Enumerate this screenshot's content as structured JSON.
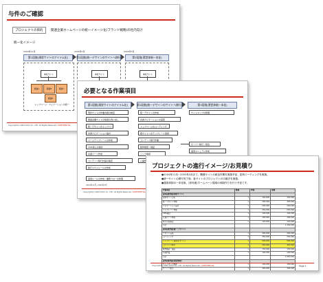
{
  "slide1": {
    "title": "与件のご確認",
    "purpose_label": "プロジェクトの目的",
    "purpose_text": "関連企業ホームページの統一イメージ化(ブランド戦略)の社内向け",
    "section_label": "統一化イメージ",
    "phases": [
      "第1段階(現状サイトのアイテム化)",
      "第2段階(統一デザインのサイトへ移行)",
      "第3段階(運営体制一本化)"
    ],
    "phase_side_labels": [
      "2004年11月",
      "2005年1月",
      "2005年3月"
    ],
    "box_labels": [
      "本社サイト",
      "関連A",
      "関連B",
      "関連C"
    ],
    "note": "トップページ・ナビゲーションの統一",
    "footer_copy": "Copyright(C) 2004 XXXX Co., LTD. All Rights Reserved.",
    "footer_mark": "CONFIDENTIAL"
  },
  "slide2": {
    "title": "必要となる作業項目",
    "phases": [
      "第1段階(現状サイトのアイテム化)",
      "第2段階(統一デザインのサイトへ移行)",
      "第3段階(運営体制一本化)"
    ],
    "col1": [
      "現状サイトの作業内容の精査",
      "関連企業サイトの情報の洗い出し",
      "統一デザインのトップページ作成",
      "共通ナビゲーション設計",
      "ページテンプレートの作成",
      "CMS導入の検討",
      "共通パーツ作成",
      "コンテンツ移行計画の策定",
      "移行スケジュールの作成",
      "運用ルールの作成・業務フローの整理"
    ],
    "col2": [
      "統一デザインの作成",
      "共通ナビゲーションの実装",
      "トップページのコーディング",
      "各サイトへのテンプレート適用",
      "コンテンツ移行作業",
      "動作確認・検証",
      "リンク確認",
      "公開作業"
    ],
    "col3": [
      "サイトマップの整理",
      "サーバー移行・統合",
      "運用マニュアル作成",
      "CMS運用トレーニング"
    ],
    "footer_left": "2004年11月~2005年3月",
    "footer_copy": "Copyright(C) 2004 XXXX Co., LTD. All Rights Reserved.",
    "footer_mark": "CONFIDENTIAL"
  },
  "slide3": {
    "title": "プロジェクトの進行イメージ/お見積り",
    "bullets": [
      "●2004年11月~2005年3月まで、関連サイトの統合作業を実施予定、定例ミーティングを実施。",
      "●統一サイトの移行完了後、各サイトのプロジェクトの引継ぎを実施。",
      "●運用体制の一本化後、(前年度)ホームページ運用の体制作りを行う予定です。"
    ],
    "table_header": [
      "作業項目",
      "数量",
      "単価",
      "金額"
    ],
    "rows": [
      {
        "cells": [
          "第1段階作業(現状サイト)",
          "",
          "",
          ""
        ],
        "type": "hdr"
      },
      {
        "cells": [
          "現状サイト分析",
          "1",
          "150,000",
          "150,000"
        ],
        "type": ""
      },
      {
        "cells": [
          "統一デザイン作成",
          "1",
          "300,000",
          "300,000"
        ],
        "type": ""
      },
      {
        "cells": [
          "ナビゲーション設計",
          "1",
          "200,000",
          "200,000"
        ],
        "type": ""
      },
      {
        "cells": [
          "テンプレート作成",
          "1",
          "250,000",
          "250,000"
        ],
        "type": ""
      },
      {
        "cells": [
          "CMS検討",
          "1",
          "100,000",
          "100,000"
        ],
        "type": ""
      },
      {
        "cells": [
          "共通パーツ作成",
          "1",
          "180,000",
          "180,000"
        ],
        "type": ""
      },
      {
        "cells": [
          "移行計画策定",
          "1",
          "120,000",
          "120,000"
        ],
        "type": ""
      },
      {
        "cells": [
          "小計",
          "",
          "",
          "1,300,000"
        ],
        "type": ""
      },
      {
        "cells": [
          "第2段階作業(統一デザイン)",
          "",
          "",
          ""
        ],
        "type": "hdr"
      },
      {
        "cells": [
          "デザイン実装",
          "1",
          "400,000",
          "400,000"
        ],
        "type": ""
      },
      {
        "cells": [
          "コーディング",
          "1",
          "350,000",
          "350,000"
        ],
        "type": ""
      },
      {
        "cells": [
          "テンプレート適用(全サイト)",
          "1",
          "500,000",
          "500,000"
        ],
        "type": "hl"
      },
      {
        "cells": [
          "コンテンツ移行",
          "1",
          "450,000",
          "450,000"
        ],
        "type": "hl"
      },
      {
        "cells": [
          "動作確認・検証",
          "1",
          "150,000",
          "150,000"
        ],
        "type": ""
      },
      {
        "cells": [
          "公開作業",
          "1",
          "100,000",
          "100,000"
        ],
        "type": ""
      },
      {
        "cells": [
          "小計",
          "",
          "",
          "1,950,000"
        ],
        "type": ""
      },
      {
        "cells": [
          "第3段階作業(運営体制)",
          "",
          "",
          ""
        ],
        "type": "hdr"
      },
      {
        "cells": [
          "サイトマップ整理",
          "1",
          "100,000",
          "100,000"
        ],
        "type": ""
      },
      {
        "cells": [
          "サーバー統合",
          "1",
          "300,000",
          "300,000"
        ],
        "type": ""
      },
      {
        "cells": [
          "運用マニュアル作成",
          "1",
          "200,000",
          "200,000"
        ],
        "type": ""
      },
      {
        "cells": [
          "トレーニング",
          "1",
          "150,000",
          "150,000"
        ],
        "type": ""
      },
      {
        "cells": [
          "小計",
          "",
          "",
          "750,000"
        ],
        "type": ""
      },
      {
        "cells": [
          "合計(税別)",
          "",
          "",
          "4,000,000"
        ],
        "type": ""
      }
    ],
    "footer_copy": "Copyright(C) 2004 XXXX Co., LTD. All Rights Reserved.",
    "footer_mark": "CONFIDENTIAL",
    "page": "Page 1"
  }
}
